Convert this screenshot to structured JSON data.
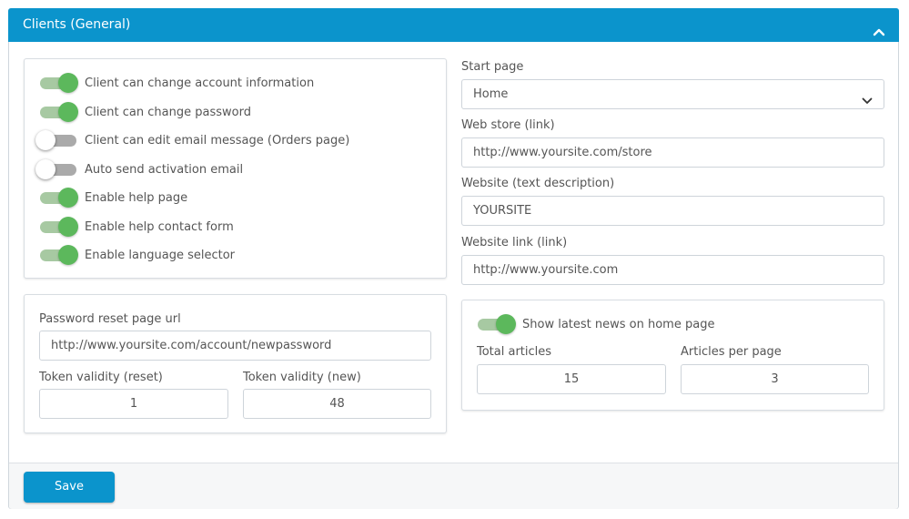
{
  "panel": {
    "title": "Clients (General)",
    "collapse_icon": "chevron-up-icon"
  },
  "client_options": [
    {
      "label": "Client can change account information",
      "enabled": true
    },
    {
      "label": "Client can change password",
      "enabled": true
    },
    {
      "label": "Client can edit email message (Orders page)",
      "enabled": false
    },
    {
      "label": "Auto send activation email",
      "enabled": false
    },
    {
      "label": "Enable help page",
      "enabled": true
    },
    {
      "label": "Enable help contact form",
      "enabled": true
    },
    {
      "label": "Enable language selector",
      "enabled": true
    }
  ],
  "password_reset": {
    "url_label": "Password reset page url",
    "url_value": "http://www.yoursite.com/account/newpassword",
    "token_reset_label": "Token validity (reset)",
    "token_reset_value": "1",
    "token_new_label": "Token validity (new)",
    "token_new_value": "48"
  },
  "site": {
    "start_page_label": "Start page",
    "start_page_value": "Home",
    "web_store_label": "Web store (link)",
    "web_store_value": "http://www.yoursite.com/store",
    "website_text_label": "Website (text description)",
    "website_text_value": "YOURSITE",
    "website_link_label": "Website link (link)",
    "website_link_value": "http://www.yoursite.com"
  },
  "news": {
    "toggle_label": "Show latest news on home page",
    "enabled": true,
    "total_label": "Total articles",
    "total_value": "15",
    "per_page_label": "Articles per page",
    "per_page_value": "3"
  },
  "footer": {
    "save_label": "Save"
  },
  "colors": {
    "accent": "#0b94cc",
    "toggle_on": "#5cb85c",
    "toggle_on_track": "#a7c9a2"
  }
}
